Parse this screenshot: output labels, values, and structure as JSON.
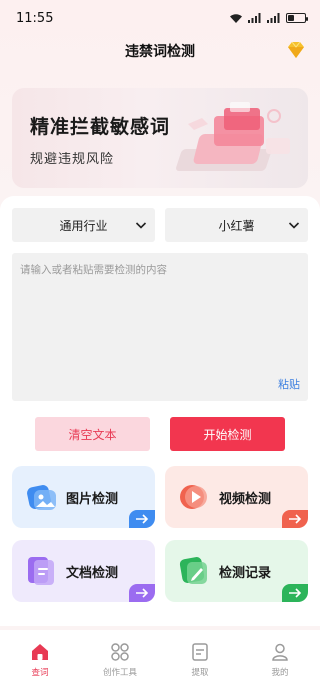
{
  "status_bar": {
    "time": "11:55"
  },
  "header": {
    "title": "违禁词检测"
  },
  "banner": {
    "title": "精准拦截敏感词",
    "subtitle": "规避违规风险"
  },
  "form": {
    "industry_select": "通用行业",
    "platform_select": "小红薯",
    "textarea_placeholder": "请输入或者粘贴需要检测的内容",
    "paste_label": "粘贴",
    "clear_button": "清空文本",
    "start_button": "开始检测"
  },
  "tiles": [
    {
      "label": "图片检测",
      "icon": "image-icon",
      "color": "#3f8cf0",
      "bg": "#e6f0fd"
    },
    {
      "label": "视频检测",
      "icon": "video-icon",
      "color": "#f0624e",
      "bg": "#fde9e5"
    },
    {
      "label": "文档检测",
      "icon": "document-icon",
      "color": "#9b6cf0",
      "bg": "#efeafc"
    },
    {
      "label": "检测记录",
      "icon": "record-icon",
      "color": "#2cb45a",
      "bg": "#e5f7e9"
    }
  ],
  "bottom_nav": [
    {
      "label": "查词",
      "icon": "home-icon",
      "active": true
    },
    {
      "label": "创作工具",
      "icon": "tools-icon",
      "active": false
    },
    {
      "label": "提取",
      "icon": "extract-icon",
      "active": false
    },
    {
      "label": "我的",
      "icon": "profile-icon",
      "active": false
    }
  ],
  "colors": {
    "accent": "#f2364f",
    "link": "#3d7fe0"
  }
}
